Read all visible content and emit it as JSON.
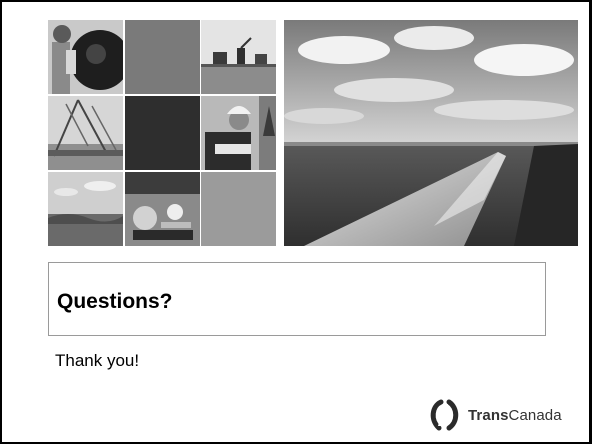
{
  "slide": {
    "question": "Questions?",
    "thanks": "Thank you!"
  },
  "logo": {
    "name_bold": "Trans",
    "name_regular": "Canada"
  },
  "colors": {
    "frame": "#000000",
    "box_border": "#9a9a9a",
    "tile_gray": "#7a7a7a",
    "tile_dark": "#2e2e2e",
    "tile_light": "#9b9b9b"
  },
  "icons": [
    "transcanada-logo-mark"
  ]
}
